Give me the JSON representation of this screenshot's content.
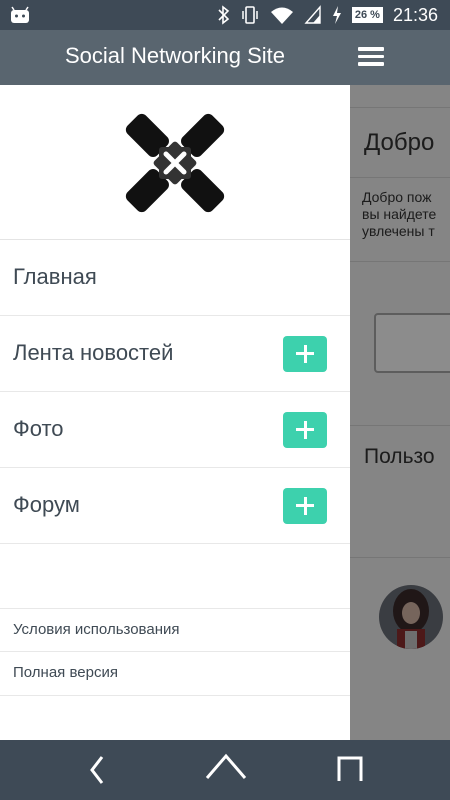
{
  "status_bar": {
    "time": "21:36",
    "battery": "26 %"
  },
  "header": {
    "title": "Social Networking Site"
  },
  "drawer": {
    "items": [
      {
        "label": "Главная",
        "has_add": false
      },
      {
        "label": "Лента новостей",
        "has_add": true
      },
      {
        "label": "Фото",
        "has_add": true
      },
      {
        "label": "Форум",
        "has_add": true
      }
    ],
    "footer_links": [
      {
        "label": "Условия использования"
      },
      {
        "label": "Полная версия"
      }
    ]
  },
  "background_page": {
    "welcome_title": "Добро",
    "welcome_text_line1": "Добро пож",
    "welcome_text_line2": "вы найдете",
    "welcome_text_line3": "увлечены т",
    "users_title": "Пользо"
  },
  "colors": {
    "accent": "#3dd1ad",
    "header": "#59656f",
    "statusbar": "#3e4a56"
  }
}
